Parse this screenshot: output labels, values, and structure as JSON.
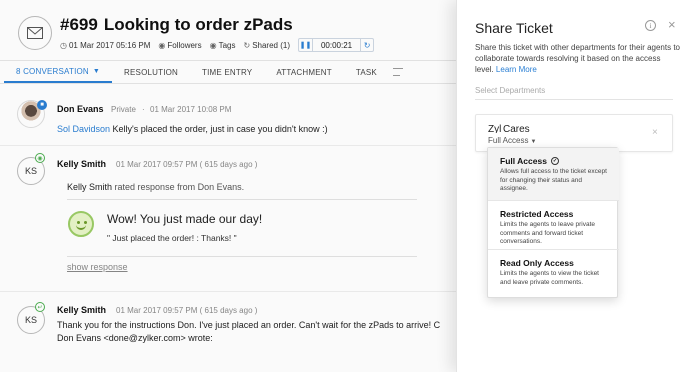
{
  "ticket": {
    "number": "#699",
    "subject": "Looking to order zPads",
    "date": "01 Mar 2017 05:16 PM",
    "followers_label": "Followers",
    "tags_label": "Tags",
    "shared_label": "Shared (1)",
    "timer": "00:00:21"
  },
  "tabs": [
    {
      "label": "8  CONVERSATION",
      "active": true
    },
    {
      "label": "RESOLUTION"
    },
    {
      "label": "TIME ENTRY"
    },
    {
      "label": "ATTACHMENT"
    },
    {
      "label": "TASK"
    }
  ],
  "threads": {
    "t1": {
      "author": "Don Evans",
      "visibility": "Private",
      "date": "01 Mar 2017 10:08 PM",
      "mention": "Sol Davidson",
      "text": "Kelly's placed the order, just in case you didn't know :)"
    },
    "t2": {
      "initials": "KS",
      "author": "Kelly Smith",
      "date": "01 Mar 2017 09:57 PM ( 615 days ago )",
      "rated_author": "Kelly Smith",
      "rated_text": "rated response from Don Evans.",
      "wow": "Wow! You just made our day!",
      "quote": "\" Just placed the order! : Thanks! \"",
      "show_response": "show response"
    },
    "t3": {
      "initials": "KS",
      "author": "Kelly Smith",
      "date": "01 Mar 2017 09:57 PM ( 615 days ago )",
      "line1": "Thank you for the instructions Don. I've just placed an order. Can't wait for the zPads to arrive! C",
      "line2": "Don Evans <done@zylker.com> wrote:"
    }
  },
  "panel": {
    "title": "Share Ticket",
    "description": "Share this ticket with other departments for their agents to collaborate towards resolving it based on the access level.",
    "learn_more": "Learn More",
    "select_placeholder": "Select Departments",
    "department": {
      "name": "Zylcares",
      "access": "Full Access"
    }
  },
  "access_options": [
    {
      "name": "Full Access",
      "desc": "Allows full access to the ticket except for changing their status and assignee.",
      "selected": true
    },
    {
      "name": "Restricted Access",
      "desc": "Limits the agents to leave private comments and forward ticket conversations."
    },
    {
      "name": "Read Only Access",
      "desc": "Limits the agents to view the ticket and leave private comments."
    }
  ],
  "colors": {
    "accent": "#2a7fd4"
  }
}
